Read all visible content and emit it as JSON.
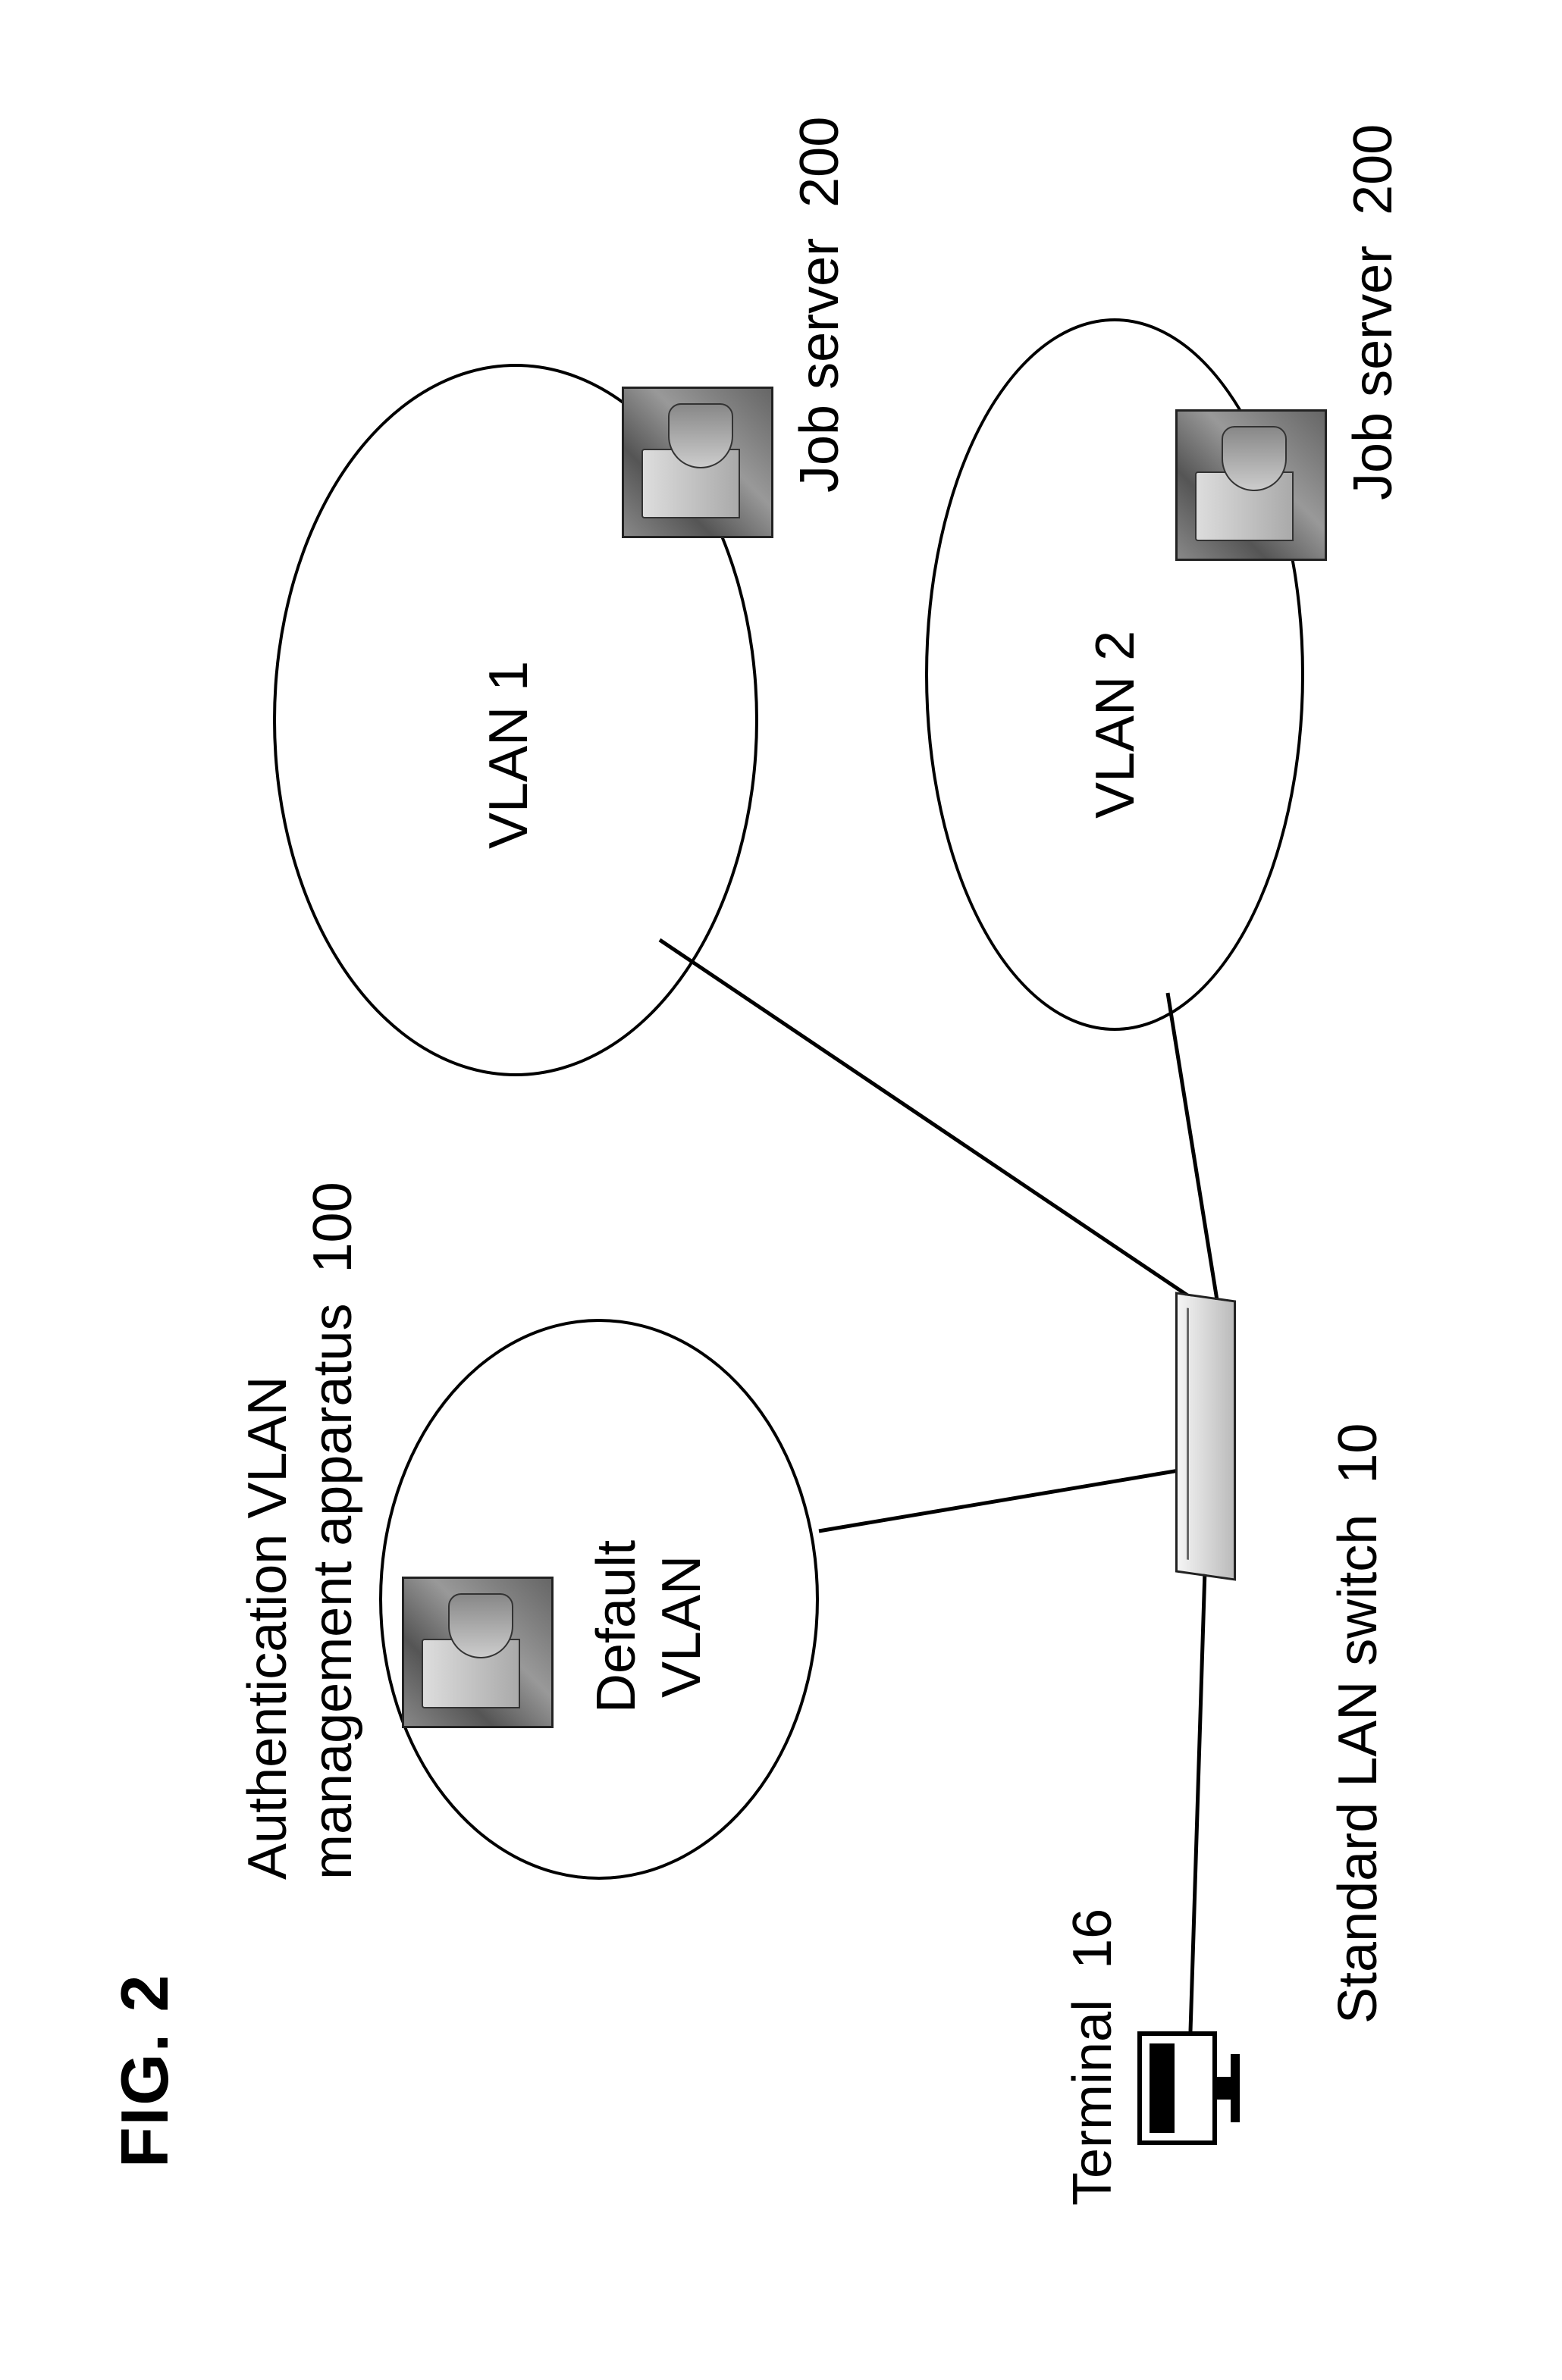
{
  "figure_label": "FIG. 2",
  "labels": {
    "auth_apparatus": "Authentication VLAN\nmanagement apparatus  100",
    "terminal": "Terminal  16",
    "switch": "Standard LAN switch  10",
    "default_vlan": "Default\nVLAN",
    "vlan1": "VLAN 1",
    "vlan2": "VLAN 2",
    "jobserver1": "Job server  200",
    "jobserver2": "Job server  200"
  },
  "chart_data": {
    "type": "diagram",
    "title": "FIG. 2",
    "nodes": [
      {
        "id": "terminal",
        "label": "Terminal",
        "number": 16,
        "type": "computer"
      },
      {
        "id": "switch",
        "label": "Standard LAN switch",
        "number": 10,
        "type": "switch"
      },
      {
        "id": "auth_apparatus",
        "label": "Authentication VLAN management apparatus",
        "number": 100,
        "type": "server",
        "vlan": "Default VLAN"
      },
      {
        "id": "jobserver_vlan1",
        "label": "Job server",
        "number": 200,
        "type": "server",
        "vlan": "VLAN 1"
      },
      {
        "id": "jobserver_vlan2",
        "label": "Job server",
        "number": 200,
        "type": "server",
        "vlan": "VLAN 2"
      }
    ],
    "vlans": [
      "Default VLAN",
      "VLAN 1",
      "VLAN 2"
    ],
    "edges": [
      {
        "from": "terminal",
        "to": "switch"
      },
      {
        "from": "switch",
        "to": "Default VLAN"
      },
      {
        "from": "switch",
        "to": "VLAN 1"
      },
      {
        "from": "switch",
        "to": "VLAN 2"
      }
    ]
  }
}
